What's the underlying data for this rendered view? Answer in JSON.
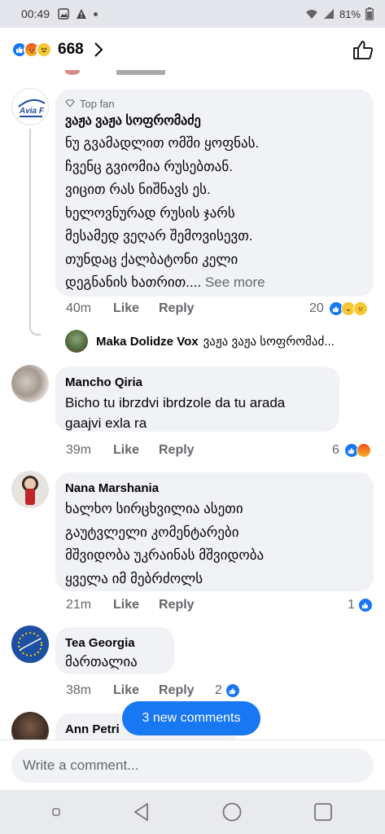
{
  "status": {
    "time": "00:49",
    "battery": "81%"
  },
  "header": {
    "reaction_count": "668"
  },
  "comments": [
    {
      "badge": "Top fan",
      "author": "ვაჟა ვაჟა სოფრომაძე",
      "avatar_text": "Avia F",
      "lines": [
        "ნუ გვამადლით ომში ყოფნას.",
        "ჩვენც გვიომია რუსებთან.",
        "ვიცით რას ნიშნავს ეს.",
        "ხელოვნურად რუსის ჯარს",
        "მესამედ ვეღარ შემოვისევთ.",
        "თუნდაც ქალბატონი კელი"
      ],
      "last_line": "დეგნანის ხათრით....",
      "see_more": "See more",
      "time": "40m",
      "like": "Like",
      "reply": "Reply",
      "reactions": "20",
      "reply_preview": {
        "author": "Maka Dolidze Vox",
        "text": "ვაჟა ვაჟა სოფრომაძ..."
      }
    },
    {
      "author": "Mancho Qiria",
      "lines": [
        "Bicho tu ibrzdvi ibrdzole da tu arada",
        "gaajvi exla ra"
      ],
      "time": "39m",
      "like": "Like",
      "reply": "Reply",
      "reactions": "6"
    },
    {
      "author": "Nana Marshania",
      "lines": [
        "ხალხო სირცხვილია ასეთი",
        "გაუტვლელი კომენტარები",
        "მშვიდობა უკრაინას მშვიდობა",
        "ყველა იმ მებრძოლს"
      ],
      "time": "21m",
      "like": "Like",
      "reply": "Reply",
      "reactions": "1"
    },
    {
      "author": "Tea Georgia",
      "lines": [
        "მართალია"
      ],
      "time": "38m",
      "like": "Like",
      "reply": "Reply",
      "reactions": "2"
    },
    {
      "author": "Ann Petri"
    }
  ],
  "new_comments": "3 new comments",
  "composer": {
    "placeholder": "Write a comment..."
  },
  "colors": {
    "accent": "#1877f2",
    "bubble": "#f0f2f5",
    "secondary_text": "#65676b"
  }
}
